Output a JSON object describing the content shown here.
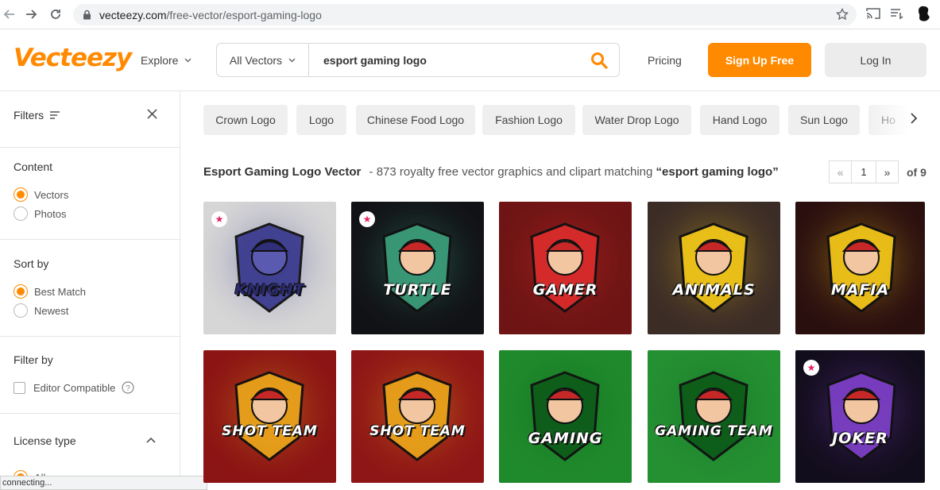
{
  "browser": {
    "url_host": "vecteezy.com",
    "url_path": "/free-vector/esport-gaming-logo"
  },
  "header": {
    "logo": "Vecteezy",
    "explore": "Explore",
    "search_category": "All Vectors",
    "search_value": "esport gaming logo",
    "pricing": "Pricing",
    "signup": "Sign Up Free",
    "login": "Log In"
  },
  "sidebar": {
    "filters_title": "Filters",
    "content": {
      "title": "Content",
      "options": [
        "Vectors",
        "Photos"
      ],
      "selected": "Vectors"
    },
    "sort": {
      "title": "Sort by",
      "options": [
        "Best Match",
        "Newest"
      ],
      "selected": "Best Match"
    },
    "filter_by": {
      "title": "Filter by",
      "option": "Editor Compatible"
    },
    "license": {
      "title": "License type",
      "option": "All"
    }
  },
  "tags": [
    "Crown Logo",
    "Logo",
    "Chinese Food Logo",
    "Fashion Logo",
    "Water Drop Logo",
    "Hand Logo",
    "Sun Logo",
    "Ho"
  ],
  "results": {
    "title": "Esport Gaming Logo Vector",
    "subtitle": "- 873 royalty free vector graphics and clipart matching",
    "query": "“esport gaming logo”",
    "page": "1",
    "of": "of 9"
  },
  "cards": [
    {
      "name": "knight",
      "text": "KNIGHT",
      "pro": true,
      "bg": "#d6d6d6",
      "accent": "#3b3b8f"
    },
    {
      "name": "turtle",
      "text": "TURTLE",
      "pro": true,
      "bg": "#111216",
      "accent": "#3a9c7a"
    },
    {
      "name": "gamer",
      "text": "GAMER",
      "pro": false,
      "bg": "#6e1414",
      "accent": "#d92b2b"
    },
    {
      "name": "animals",
      "text": "ANIMALS",
      "pro": false,
      "bg": "#3b2c26",
      "accent": "#f0c419"
    },
    {
      "name": "mafia",
      "text": "MAFIA",
      "pro": false,
      "bg": "#2a0f0f",
      "accent": "#f0c419"
    },
    {
      "name": "shot-team-1",
      "text": "SHOT TEAM",
      "pro": false,
      "bg": "#8b1414",
      "accent": "#e8a21b"
    },
    {
      "name": "shot-team-2",
      "text": "SHOT TEAM",
      "pro": false,
      "bg": "#8f1616",
      "accent": "#e8a21b"
    },
    {
      "name": "gaming-awesome",
      "text": "GAMING",
      "pro": false,
      "bg": "#1f8a2b",
      "accent": "#0e5c1a"
    },
    {
      "name": "gaming-team",
      "text": "GAMING TEAM",
      "pro": false,
      "bg": "#249032",
      "accent": "#0e5c1a"
    },
    {
      "name": "joker",
      "text": "JOKER",
      "pro": true,
      "bg": "#120d1c",
      "accent": "#7b3fc4"
    }
  ],
  "status": "connecting..."
}
